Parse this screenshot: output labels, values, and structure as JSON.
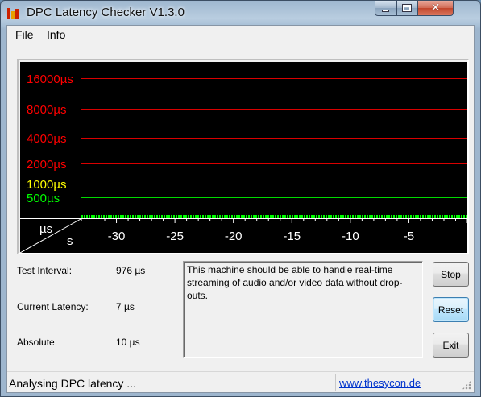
{
  "window": {
    "title": "DPC Latency Checker V1.3.0",
    "minimize_glyph": "",
    "close_glyph": "✕"
  },
  "menu": {
    "items": [
      "File",
      "Info"
    ]
  },
  "graph": {
    "y_unit": "µs",
    "x_unit": "s",
    "y_ticks": [
      {
        "label": "16000µs",
        "value": 16000,
        "color": "#ff0000"
      },
      {
        "label": "8000µs",
        "value": 8000,
        "color": "#ff0000"
      },
      {
        "label": "4000µs",
        "value": 4000,
        "color": "#ff0000"
      },
      {
        "label": "2000µs",
        "value": 2000,
        "color": "#ff0000"
      },
      {
        "label": "1000µs",
        "value": 1000,
        "color": "#ffff00"
      },
      {
        "label": "500µs",
        "value": 500,
        "color": "#00ff00"
      }
    ],
    "x_ticks": [
      "-30",
      "-25",
      "-20",
      "-15",
      "-10",
      "-5"
    ],
    "x_range_s": [
      -33,
      0
    ],
    "bar_color": "#00ff00",
    "background": "#000000"
  },
  "stats": {
    "test_interval_label": "Test Interval:",
    "test_interval_value": "976 µs",
    "current_latency_label": "Current Latency:",
    "current_latency_value": "7 µs",
    "absolute_label": "Absolute",
    "absolute_value": "10 µs"
  },
  "message": "This machine should be able to handle real-time streaming of audio and/or video data without drop-outs.",
  "buttons": {
    "stop": "Stop",
    "reset": "Reset",
    "exit": "Exit"
  },
  "status": {
    "text": "Analysing DPC latency ...",
    "link": "www.thesycon.de"
  }
}
